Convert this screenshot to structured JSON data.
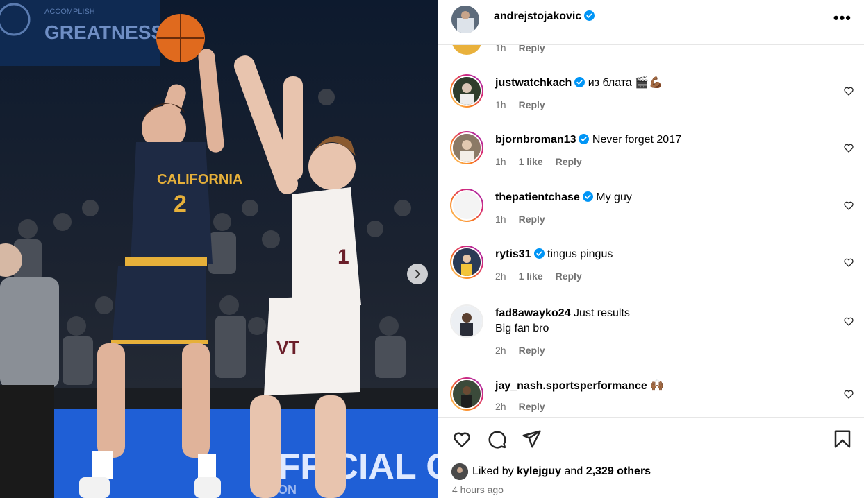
{
  "header": {
    "username": "andrejstojakovic",
    "more_label": "•••"
  },
  "photo": {
    "banner_text": "GREATNESS",
    "banner_small": "ACCOMPLISH",
    "jersey_text": "CALIFORNIA",
    "jersey_number": "2",
    "opponent_number": "1",
    "shorts_text": "VT",
    "court_text": "OFFICIAL GR",
    "court_sub": "O LION"
  },
  "partial_comment": {
    "time": "1h",
    "reply": "Reply"
  },
  "comments": [
    {
      "user": "justwatchkach",
      "verified": true,
      "text": "из блата 🎬💪🏾",
      "time": "1h",
      "likes": "",
      "reply": "Reply"
    },
    {
      "user": "bjornbroman13",
      "verified": true,
      "text": "Never forget 2017",
      "time": "1h",
      "likes": "1 like",
      "reply": "Reply"
    },
    {
      "user": "thepatientchase",
      "verified": true,
      "text": "My guy",
      "time": "1h",
      "likes": "",
      "reply": "Reply"
    },
    {
      "user": "rytis31",
      "verified": true,
      "text": "tingus pingus",
      "time": "2h",
      "likes": "1 like",
      "reply": "Reply"
    },
    {
      "user": "fad8awayko24",
      "verified": false,
      "text": "Just results",
      "text2": "Big fan bro",
      "time": "2h",
      "likes": "",
      "reply": "Reply"
    },
    {
      "user": "jay_nash.sportsperformance",
      "verified": false,
      "text": "🙌🏾",
      "time": "2h",
      "likes": "",
      "reply": "Reply"
    }
  ],
  "likes": {
    "prefix": "Liked by",
    "user": "kylejguy",
    "middle": "and",
    "others": "2,329 others"
  },
  "posted": "4 hours ago",
  "colors": {
    "verified": "#0095f6",
    "muted": "#737373",
    "cal_navy": "#1e2a44",
    "cal_gold": "#e6b03a",
    "vt_maroon": "#6b1f2a",
    "court_blue": "#1f5fd6"
  }
}
